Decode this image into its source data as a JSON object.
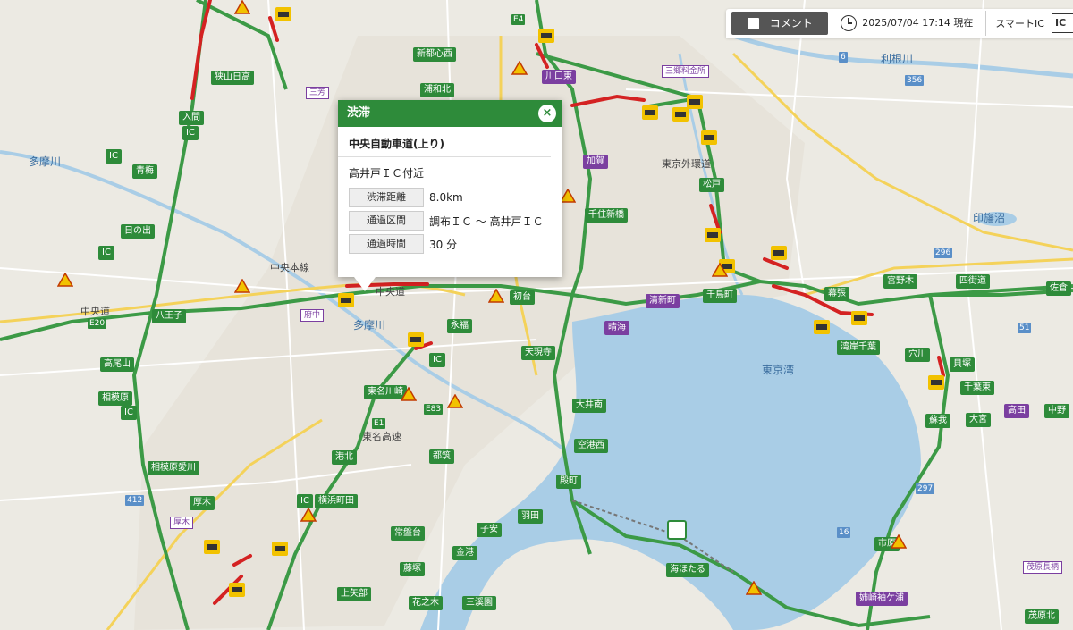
{
  "topbar": {
    "comment_label": "コメント",
    "time_label": "2025/07/04 17:14 現在",
    "smartic_label": "スマートIC",
    "smartic_badge": "IC"
  },
  "popup": {
    "header": "渋滞",
    "close_glyph": "×",
    "road": "中央自動車道(上り)",
    "location": "高井戸ＩＣ付近",
    "rows": [
      {
        "key": "渋滞距離",
        "value": "8.0km"
      },
      {
        "key": "通過区間",
        "value": "調布ＩＣ 〜 高井戸ＩＣ"
      },
      {
        "key": "通過時間",
        "value": "30 分"
      }
    ]
  },
  "map": {
    "water_names": [
      "東京湾",
      "多摩川",
      "多摩川",
      "利根川",
      "印旛沼"
    ],
    "places": [
      "中央本線",
      "中央道",
      "東名高速",
      "中央道",
      "東京外環道"
    ],
    "ic_labels": [
      "狭山日高",
      "入間",
      "IC",
      "IC",
      "青梅",
      "日の出",
      "IC",
      "八王子",
      "高尾山",
      "相模原",
      "IC",
      "相模原愛川",
      "厚木",
      "IC",
      "横浜町田",
      "港北",
      "都筑",
      "IC",
      "東名川崎",
      "大井南",
      "空港西",
      "殿町",
      "金港",
      "子安",
      "羽田",
      "常盤台",
      "藤塚",
      "上矢部",
      "花之木",
      "三溪園",
      "千住新橋",
      "加賀",
      "初台",
      "永福",
      "天現寺",
      "清新町",
      "晴海",
      "千鳥町",
      "松戸",
      "幕張",
      "湾岸千葉",
      "四街道",
      "宮野木",
      "穴川",
      "貝塚",
      "千葉東",
      "高田",
      "大宮",
      "蘇我",
      "市原",
      "姉崎袖ケ浦",
      "茂原長柄",
      "茂原北",
      "佐倉",
      "中野",
      "海ほたる",
      "三郷料金所",
      "川口東",
      "浦和北",
      "新都心西",
      "E4",
      "E20",
      "E1",
      "E83",
      "412",
      "297",
      "356",
      "296",
      "51",
      "6",
      "16"
    ],
    "smart_ic_labels": [
      "三芳",
      "府中",
      "厚木",
      "三郷料金所",
      "茂原長柄"
    ],
    "icon_names": [
      "traffic-jam-icon",
      "warning-icon",
      "parking-area-icon"
    ]
  }
}
